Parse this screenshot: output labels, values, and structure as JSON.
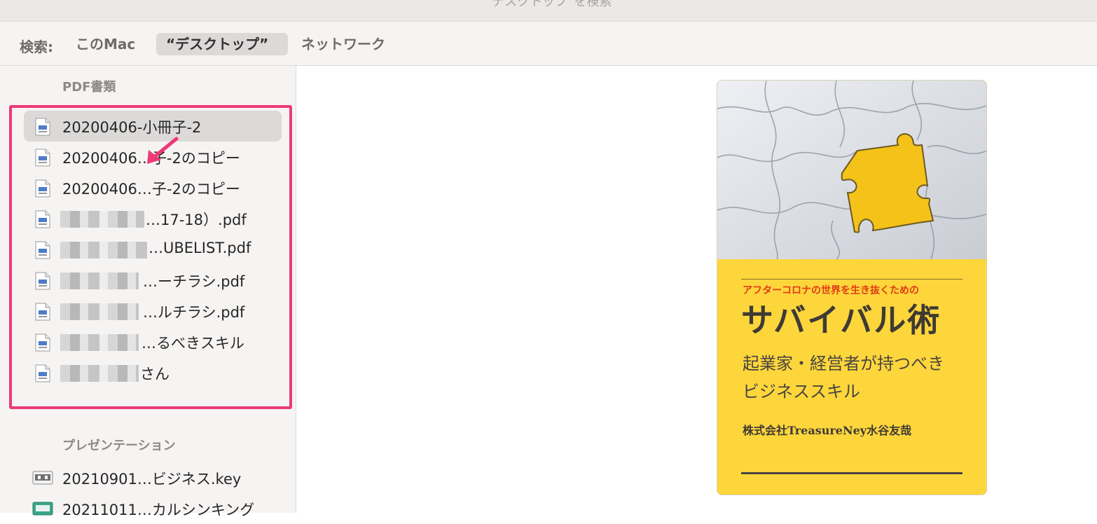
{
  "window": {
    "title": "“デスクトップ”を検索"
  },
  "scope_bar": {
    "label": "検索:",
    "options": [
      "このMac",
      "“デスクトップ”",
      "ネットワーク"
    ],
    "selected": "“デスクトップ”"
  },
  "sidebar": {
    "groups": [
      {
        "header": "PDF書類",
        "items": [
          {
            "label": "20200406-小冊子-2",
            "selected": true,
            "redacted": false
          },
          {
            "label": "20200406…子-2のコピー",
            "selected": false,
            "redacted": false
          },
          {
            "label": "20200406…子-2のコピー",
            "selected": false,
            "redacted": false
          },
          {
            "label": "…17-18）.pdf",
            "selected": false,
            "redacted": true
          },
          {
            "label": "…UBELIST.pdf",
            "selected": false,
            "redacted": true
          },
          {
            "label": "…ーチラシ.pdf",
            "selected": false,
            "redacted": true
          },
          {
            "label": "…ルチラシ.pdf",
            "selected": false,
            "redacted": true
          },
          {
            "label": "…るべきスキル",
            "selected": false,
            "redacted": true
          },
          {
            "label": "さん",
            "selected": false,
            "redacted": true
          }
        ]
      },
      {
        "header": "プレゼンテーション",
        "items": [
          {
            "label": "20210901…ビジネス.key",
            "icon": "keynote-icon"
          },
          {
            "label": "20211011…カルシンキング",
            "icon": "keynote-icon"
          }
        ]
      }
    ]
  },
  "annotation": {
    "highlight_color": "#ec3a78"
  },
  "preview": {
    "cover": {
      "subtitle": "アフターコロナの世界を生き抜くための",
      "title": "サバイバル術",
      "tagline_line1": "起業家・経営者が持つべき",
      "tagline_line2": "ビジネススキル",
      "author": "株式会社TreasureNey水谷友哉",
      "colors": {
        "background": "#fdd63c",
        "subtitle": "#e13a12",
        "text": "#3f3a34"
      }
    }
  }
}
